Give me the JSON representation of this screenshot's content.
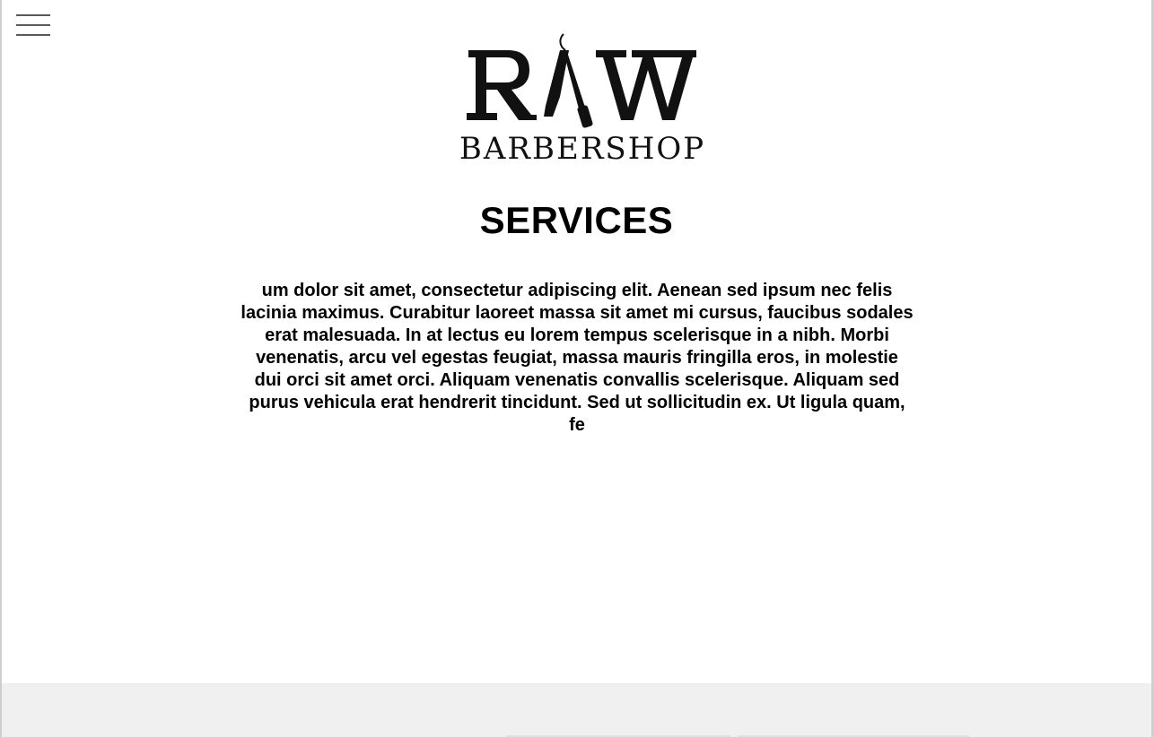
{
  "header": {
    "menu_icon": "hamburger-menu-icon",
    "logo": {
      "brand": "RAW",
      "subtitle": "BARBERSHOP",
      "icon": "straight-razor-icon"
    }
  },
  "services": {
    "title": "SERVICES",
    "description": "um dolor sit amet, consectetur adipiscing elit. Aenean sed ipsum nec felis lacinia maximus. Curabitur laoreet massa sit amet mi cursus, faucibus sodales erat malesuada. In at lectus eu lorem tempus scelerisque in a nibh. Morbi venenatis, arcu vel egestas feugiat, massa mauris fringilla eros, in molestie dui orci sit amet orci. Aliquam venenatis convallis scelerisque. Aliquam sed purus vehicula erat hendrerit tincidunt. Sed ut sollicitudin ex. Ut ligula quam, fe"
  },
  "colors": {
    "text": "#000000",
    "background": "#ffffff",
    "footer_band": "#f0f0f0"
  }
}
